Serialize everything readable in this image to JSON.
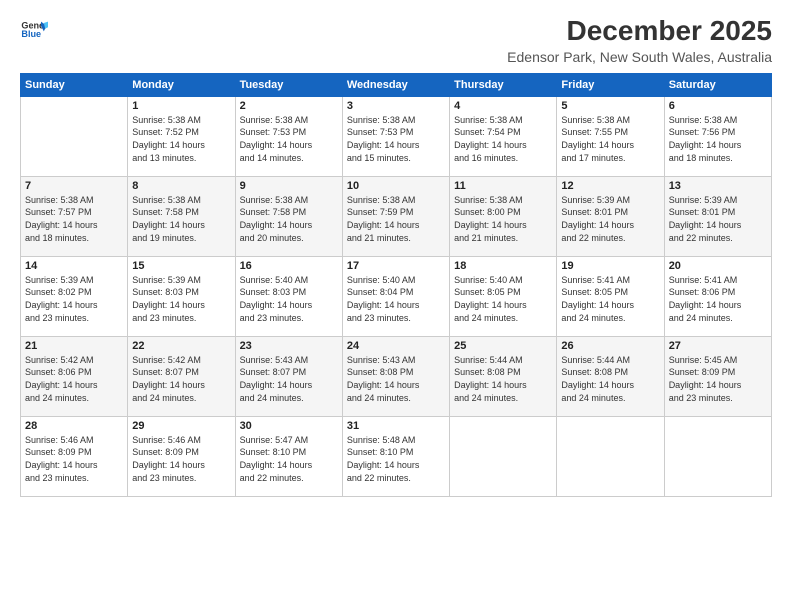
{
  "logo": {
    "general": "General",
    "blue": "Blue"
  },
  "header": {
    "title": "December 2025",
    "subtitle": "Edensor Park, New South Wales, Australia"
  },
  "days_of_week": [
    "Sunday",
    "Monday",
    "Tuesday",
    "Wednesday",
    "Thursday",
    "Friday",
    "Saturday"
  ],
  "weeks": [
    [
      {
        "day": "",
        "info": ""
      },
      {
        "day": "1",
        "info": "Sunrise: 5:38 AM\nSunset: 7:52 PM\nDaylight: 14 hours\nand 13 minutes."
      },
      {
        "day": "2",
        "info": "Sunrise: 5:38 AM\nSunset: 7:53 PM\nDaylight: 14 hours\nand 14 minutes."
      },
      {
        "day": "3",
        "info": "Sunrise: 5:38 AM\nSunset: 7:53 PM\nDaylight: 14 hours\nand 15 minutes."
      },
      {
        "day": "4",
        "info": "Sunrise: 5:38 AM\nSunset: 7:54 PM\nDaylight: 14 hours\nand 16 minutes."
      },
      {
        "day": "5",
        "info": "Sunrise: 5:38 AM\nSunset: 7:55 PM\nDaylight: 14 hours\nand 17 minutes."
      },
      {
        "day": "6",
        "info": "Sunrise: 5:38 AM\nSunset: 7:56 PM\nDaylight: 14 hours\nand 18 minutes."
      }
    ],
    [
      {
        "day": "7",
        "info": "Sunrise: 5:38 AM\nSunset: 7:57 PM\nDaylight: 14 hours\nand 18 minutes."
      },
      {
        "day": "8",
        "info": "Sunrise: 5:38 AM\nSunset: 7:58 PM\nDaylight: 14 hours\nand 19 minutes."
      },
      {
        "day": "9",
        "info": "Sunrise: 5:38 AM\nSunset: 7:58 PM\nDaylight: 14 hours\nand 20 minutes."
      },
      {
        "day": "10",
        "info": "Sunrise: 5:38 AM\nSunset: 7:59 PM\nDaylight: 14 hours\nand 21 minutes."
      },
      {
        "day": "11",
        "info": "Sunrise: 5:38 AM\nSunset: 8:00 PM\nDaylight: 14 hours\nand 21 minutes."
      },
      {
        "day": "12",
        "info": "Sunrise: 5:39 AM\nSunset: 8:01 PM\nDaylight: 14 hours\nand 22 minutes."
      },
      {
        "day": "13",
        "info": "Sunrise: 5:39 AM\nSunset: 8:01 PM\nDaylight: 14 hours\nand 22 minutes."
      }
    ],
    [
      {
        "day": "14",
        "info": "Sunrise: 5:39 AM\nSunset: 8:02 PM\nDaylight: 14 hours\nand 23 minutes."
      },
      {
        "day": "15",
        "info": "Sunrise: 5:39 AM\nSunset: 8:03 PM\nDaylight: 14 hours\nand 23 minutes."
      },
      {
        "day": "16",
        "info": "Sunrise: 5:40 AM\nSunset: 8:03 PM\nDaylight: 14 hours\nand 23 minutes."
      },
      {
        "day": "17",
        "info": "Sunrise: 5:40 AM\nSunset: 8:04 PM\nDaylight: 14 hours\nand 23 minutes."
      },
      {
        "day": "18",
        "info": "Sunrise: 5:40 AM\nSunset: 8:05 PM\nDaylight: 14 hours\nand 24 minutes."
      },
      {
        "day": "19",
        "info": "Sunrise: 5:41 AM\nSunset: 8:05 PM\nDaylight: 14 hours\nand 24 minutes."
      },
      {
        "day": "20",
        "info": "Sunrise: 5:41 AM\nSunset: 8:06 PM\nDaylight: 14 hours\nand 24 minutes."
      }
    ],
    [
      {
        "day": "21",
        "info": "Sunrise: 5:42 AM\nSunset: 8:06 PM\nDaylight: 14 hours\nand 24 minutes."
      },
      {
        "day": "22",
        "info": "Sunrise: 5:42 AM\nSunset: 8:07 PM\nDaylight: 14 hours\nand 24 minutes."
      },
      {
        "day": "23",
        "info": "Sunrise: 5:43 AM\nSunset: 8:07 PM\nDaylight: 14 hours\nand 24 minutes."
      },
      {
        "day": "24",
        "info": "Sunrise: 5:43 AM\nSunset: 8:08 PM\nDaylight: 14 hours\nand 24 minutes."
      },
      {
        "day": "25",
        "info": "Sunrise: 5:44 AM\nSunset: 8:08 PM\nDaylight: 14 hours\nand 24 minutes."
      },
      {
        "day": "26",
        "info": "Sunrise: 5:44 AM\nSunset: 8:08 PM\nDaylight: 14 hours\nand 24 minutes."
      },
      {
        "day": "27",
        "info": "Sunrise: 5:45 AM\nSunset: 8:09 PM\nDaylight: 14 hours\nand 23 minutes."
      }
    ],
    [
      {
        "day": "28",
        "info": "Sunrise: 5:46 AM\nSunset: 8:09 PM\nDaylight: 14 hours\nand 23 minutes."
      },
      {
        "day": "29",
        "info": "Sunrise: 5:46 AM\nSunset: 8:09 PM\nDaylight: 14 hours\nand 23 minutes."
      },
      {
        "day": "30",
        "info": "Sunrise: 5:47 AM\nSunset: 8:10 PM\nDaylight: 14 hours\nand 22 minutes."
      },
      {
        "day": "31",
        "info": "Sunrise: 5:48 AM\nSunset: 8:10 PM\nDaylight: 14 hours\nand 22 minutes."
      },
      {
        "day": "",
        "info": ""
      },
      {
        "day": "",
        "info": ""
      },
      {
        "day": "",
        "info": ""
      }
    ]
  ]
}
